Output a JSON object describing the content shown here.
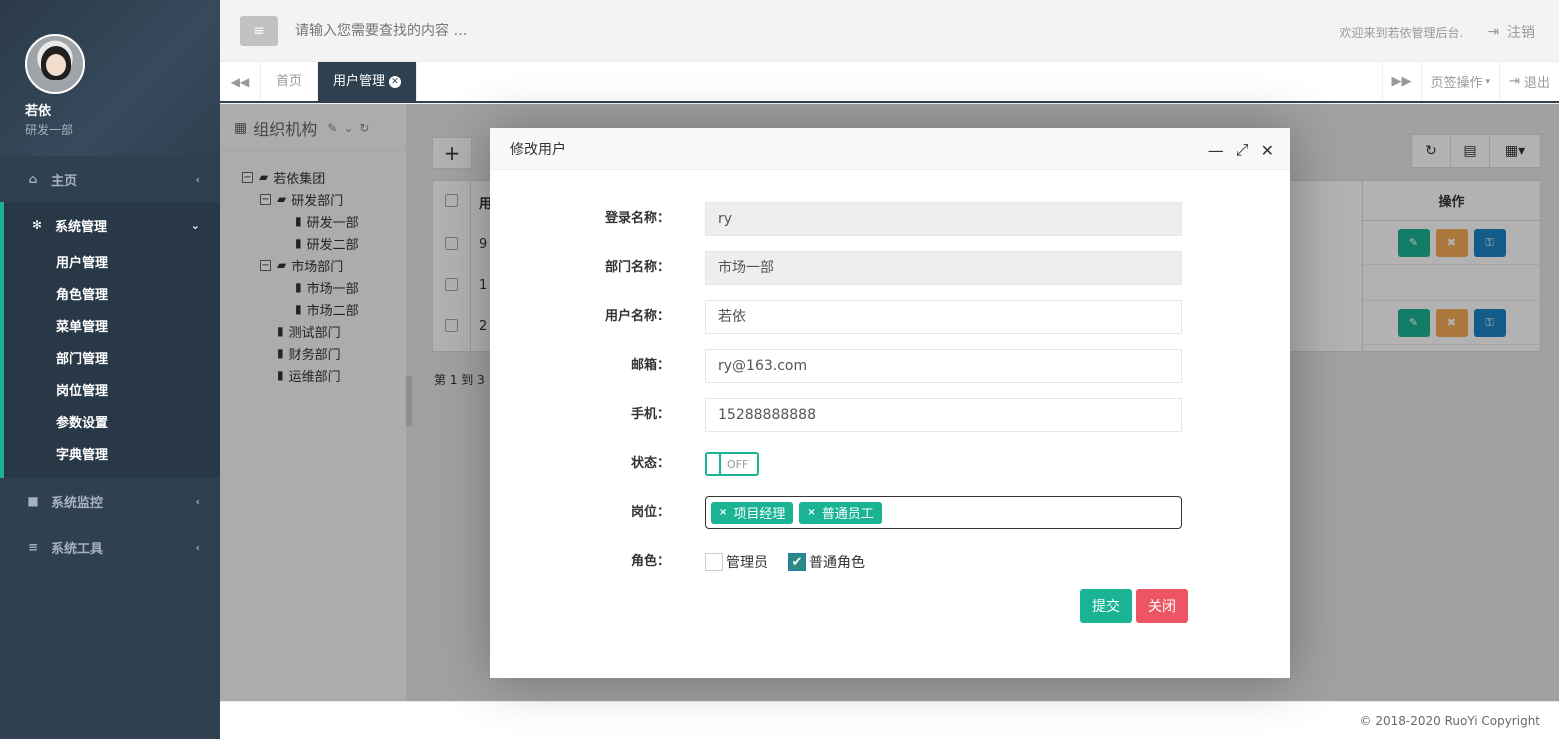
{
  "sidebar": {
    "user_name": "若依",
    "user_dept": "研发一部",
    "nav": [
      {
        "label": "主页",
        "icon": "home-icon"
      },
      {
        "label": "系统管理",
        "icon": "gear-icon"
      },
      {
        "label": "系统监控",
        "icon": "video-icon"
      },
      {
        "label": "系统工具",
        "icon": "bars-icon"
      }
    ],
    "subnav": [
      "用户管理",
      "角色管理",
      "菜单管理",
      "部门管理",
      "岗位管理",
      "参数设置",
      "字典管理"
    ]
  },
  "topbar": {
    "search_placeholder": "请输入您需要查找的内容 …",
    "welcome": "欢迎来到若依管理后台.",
    "logout": "注销"
  },
  "tabs": {
    "home": "首页",
    "user_mgmt": "用户管理",
    "tab_ops": "页签操作",
    "exit": "退出"
  },
  "org_panel": {
    "title": "组织机构",
    "tree": [
      {
        "label": "若依集团",
        "level": 0,
        "type": "folder"
      },
      {
        "label": "研发部门",
        "level": 1,
        "type": "folder"
      },
      {
        "label": "研发一部",
        "level": 2,
        "type": "file"
      },
      {
        "label": "研发二部",
        "level": 2,
        "type": "file"
      },
      {
        "label": "市场部门",
        "level": 1,
        "type": "folder"
      },
      {
        "label": "市场一部",
        "level": 2,
        "type": "file"
      },
      {
        "label": "市场二部",
        "level": 2,
        "type": "file"
      },
      {
        "label": "测试部门",
        "level": 1,
        "type": "file"
      },
      {
        "label": "财务部门",
        "level": 1,
        "type": "file"
      },
      {
        "label": "运维部门",
        "level": 1,
        "type": "file"
      }
    ]
  },
  "table": {
    "op_header": "操作",
    "col1_head": "用",
    "row_values": [
      "9",
      "1",
      "2"
    ],
    "pagination": "第 1 到 3"
  },
  "modal": {
    "title": "修改用户",
    "fields": {
      "login_label": "登录名称：",
      "login_value": "ry",
      "dept_label": "部门名称：",
      "dept_value": "市场一部",
      "username_label": "用户名称：",
      "username_value": "若依",
      "email_label": "邮箱：",
      "email_value": "ry@163.com",
      "phone_label": "手机：",
      "phone_value": "15288888888",
      "status_label": "状态：",
      "status_value": "OFF",
      "post_label": "岗位：",
      "posts": [
        "项目经理",
        "普通员工"
      ],
      "role_label": "角色：",
      "roles": [
        {
          "label": "管理员",
          "checked": false
        },
        {
          "label": "普通角色",
          "checked": true
        }
      ]
    },
    "submit": "提交",
    "close": "关闭"
  },
  "footer": {
    "copyright": "© 2018-2020 RuoYi Copyright"
  },
  "colors": {
    "sidebar": "#2f4050",
    "accent": "#1ab394",
    "danger": "#ed5565",
    "warning": "#f8ac59",
    "info": "#1c84c6"
  }
}
